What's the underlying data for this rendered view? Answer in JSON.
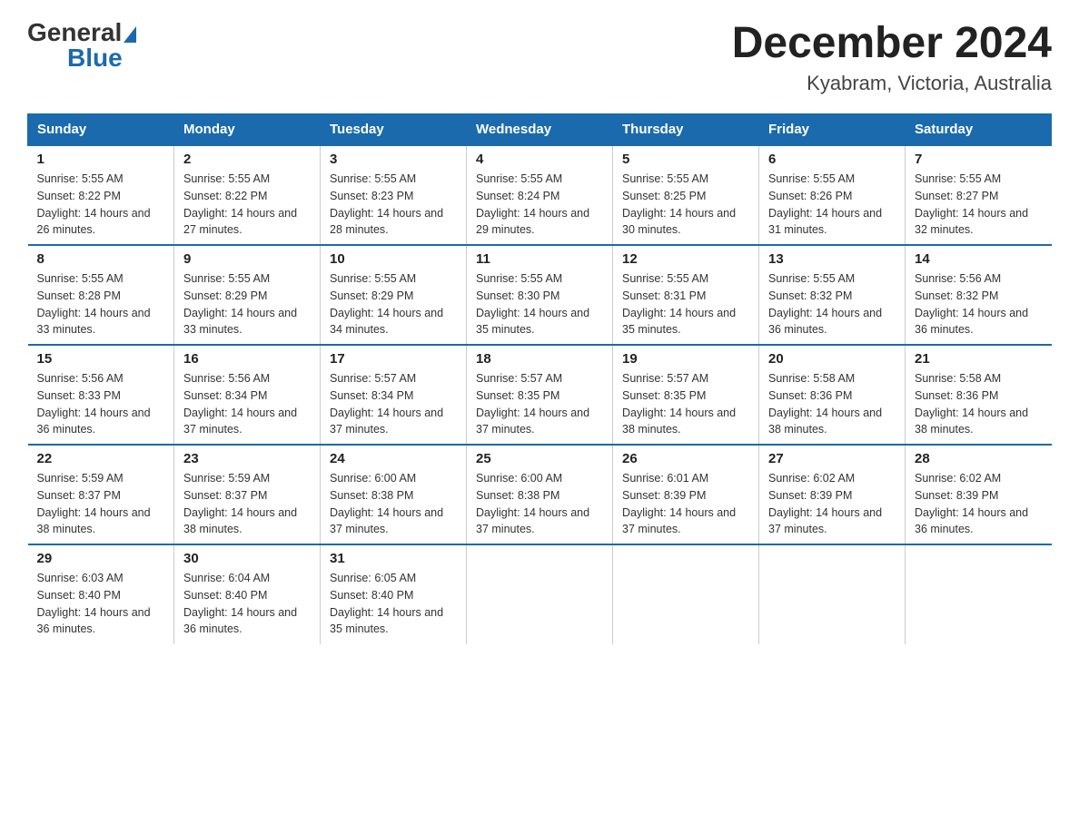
{
  "header": {
    "logo_general": "General",
    "logo_blue": "Blue",
    "month_title": "December 2024",
    "location": "Kyabram, Victoria, Australia"
  },
  "days_of_week": [
    "Sunday",
    "Monday",
    "Tuesday",
    "Wednesday",
    "Thursday",
    "Friday",
    "Saturday"
  ],
  "weeks": [
    [
      {
        "num": "1",
        "sunrise": "5:55 AM",
        "sunset": "8:22 PM",
        "daylight": "14 hours and 26 minutes."
      },
      {
        "num": "2",
        "sunrise": "5:55 AM",
        "sunset": "8:22 PM",
        "daylight": "14 hours and 27 minutes."
      },
      {
        "num": "3",
        "sunrise": "5:55 AM",
        "sunset": "8:23 PM",
        "daylight": "14 hours and 28 minutes."
      },
      {
        "num": "4",
        "sunrise": "5:55 AM",
        "sunset": "8:24 PM",
        "daylight": "14 hours and 29 minutes."
      },
      {
        "num": "5",
        "sunrise": "5:55 AM",
        "sunset": "8:25 PM",
        "daylight": "14 hours and 30 minutes."
      },
      {
        "num": "6",
        "sunrise": "5:55 AM",
        "sunset": "8:26 PM",
        "daylight": "14 hours and 31 minutes."
      },
      {
        "num": "7",
        "sunrise": "5:55 AM",
        "sunset": "8:27 PM",
        "daylight": "14 hours and 32 minutes."
      }
    ],
    [
      {
        "num": "8",
        "sunrise": "5:55 AM",
        "sunset": "8:28 PM",
        "daylight": "14 hours and 33 minutes."
      },
      {
        "num": "9",
        "sunrise": "5:55 AM",
        "sunset": "8:29 PM",
        "daylight": "14 hours and 33 minutes."
      },
      {
        "num": "10",
        "sunrise": "5:55 AM",
        "sunset": "8:29 PM",
        "daylight": "14 hours and 34 minutes."
      },
      {
        "num": "11",
        "sunrise": "5:55 AM",
        "sunset": "8:30 PM",
        "daylight": "14 hours and 35 minutes."
      },
      {
        "num": "12",
        "sunrise": "5:55 AM",
        "sunset": "8:31 PM",
        "daylight": "14 hours and 35 minutes."
      },
      {
        "num": "13",
        "sunrise": "5:55 AM",
        "sunset": "8:32 PM",
        "daylight": "14 hours and 36 minutes."
      },
      {
        "num": "14",
        "sunrise": "5:56 AM",
        "sunset": "8:32 PM",
        "daylight": "14 hours and 36 minutes."
      }
    ],
    [
      {
        "num": "15",
        "sunrise": "5:56 AM",
        "sunset": "8:33 PM",
        "daylight": "14 hours and 36 minutes."
      },
      {
        "num": "16",
        "sunrise": "5:56 AM",
        "sunset": "8:34 PM",
        "daylight": "14 hours and 37 minutes."
      },
      {
        "num": "17",
        "sunrise": "5:57 AM",
        "sunset": "8:34 PM",
        "daylight": "14 hours and 37 minutes."
      },
      {
        "num": "18",
        "sunrise": "5:57 AM",
        "sunset": "8:35 PM",
        "daylight": "14 hours and 37 minutes."
      },
      {
        "num": "19",
        "sunrise": "5:57 AM",
        "sunset": "8:35 PM",
        "daylight": "14 hours and 38 minutes."
      },
      {
        "num": "20",
        "sunrise": "5:58 AM",
        "sunset": "8:36 PM",
        "daylight": "14 hours and 38 minutes."
      },
      {
        "num": "21",
        "sunrise": "5:58 AM",
        "sunset": "8:36 PM",
        "daylight": "14 hours and 38 minutes."
      }
    ],
    [
      {
        "num": "22",
        "sunrise": "5:59 AM",
        "sunset": "8:37 PM",
        "daylight": "14 hours and 38 minutes."
      },
      {
        "num": "23",
        "sunrise": "5:59 AM",
        "sunset": "8:37 PM",
        "daylight": "14 hours and 38 minutes."
      },
      {
        "num": "24",
        "sunrise": "6:00 AM",
        "sunset": "8:38 PM",
        "daylight": "14 hours and 37 minutes."
      },
      {
        "num": "25",
        "sunrise": "6:00 AM",
        "sunset": "8:38 PM",
        "daylight": "14 hours and 37 minutes."
      },
      {
        "num": "26",
        "sunrise": "6:01 AM",
        "sunset": "8:39 PM",
        "daylight": "14 hours and 37 minutes."
      },
      {
        "num": "27",
        "sunrise": "6:02 AM",
        "sunset": "8:39 PM",
        "daylight": "14 hours and 37 minutes."
      },
      {
        "num": "28",
        "sunrise": "6:02 AM",
        "sunset": "8:39 PM",
        "daylight": "14 hours and 36 minutes."
      }
    ],
    [
      {
        "num": "29",
        "sunrise": "6:03 AM",
        "sunset": "8:40 PM",
        "daylight": "14 hours and 36 minutes."
      },
      {
        "num": "30",
        "sunrise": "6:04 AM",
        "sunset": "8:40 PM",
        "daylight": "14 hours and 36 minutes."
      },
      {
        "num": "31",
        "sunrise": "6:05 AM",
        "sunset": "8:40 PM",
        "daylight": "14 hours and 35 minutes."
      },
      null,
      null,
      null,
      null
    ]
  ]
}
